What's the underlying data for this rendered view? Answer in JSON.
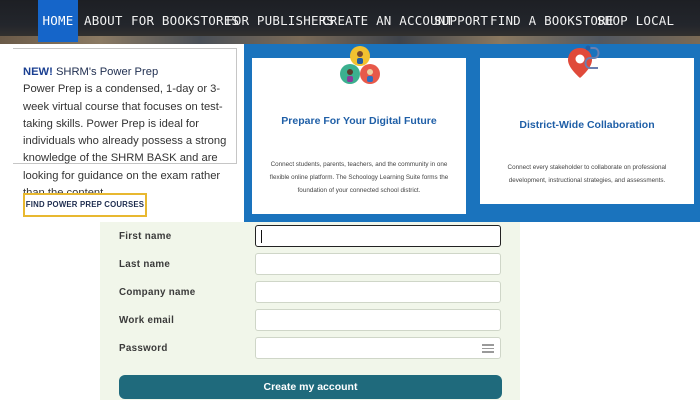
{
  "nav": {
    "items": [
      "HOME",
      "ABOUT",
      "FOR BOOKSTORES",
      "FOR PUBLISHERS",
      "CREATE AN ACCOUNT",
      "SUPPORT",
      "FIND A BOOKSTORE",
      "SHOP LOCAL"
    ],
    "active": "HOME"
  },
  "promo": {
    "new_label": "NEW!",
    "title": "SHRM's Power Prep",
    "body": "Power Prep is a condensed, 1-day or 3-week virtual course that focuses on test-taking skills. Power Prep is ideal for individuals who already possess a strong knowledge of the SHRM BASK and are looking for guidance on the exam rather than the content.",
    "button_label": "FIND POWER PREP COURSES"
  },
  "cards": [
    {
      "title": "Prepare For Your Digital Future",
      "body": "Connect students, parents, teachers, and the community in one flexible online platform. The Schoology Learning Suite forms the foundation of your connected school district.",
      "icon": "people-circles-icon"
    },
    {
      "title": "District-Wide Collaboration",
      "body": "Connect every stakeholder to collaborate on professional development, instructional strategies, and assessments.",
      "icon": "map-pin-route-icon"
    }
  ],
  "form": {
    "fields": [
      {
        "label": "First name",
        "value": ""
      },
      {
        "label": "Last name",
        "value": ""
      },
      {
        "label": "Company name",
        "value": ""
      },
      {
        "label": "Work email",
        "value": ""
      },
      {
        "label": "Password",
        "value": ""
      }
    ],
    "submit_label": "Create my account"
  },
  "colors": {
    "nav_active": "#1565c9",
    "band_blue": "#1a73bd",
    "card_title": "#1f5fa7",
    "promo_button_border": "#e8b830",
    "submit_button": "#1f6a7c",
    "form_background": "#f1f6ea"
  }
}
